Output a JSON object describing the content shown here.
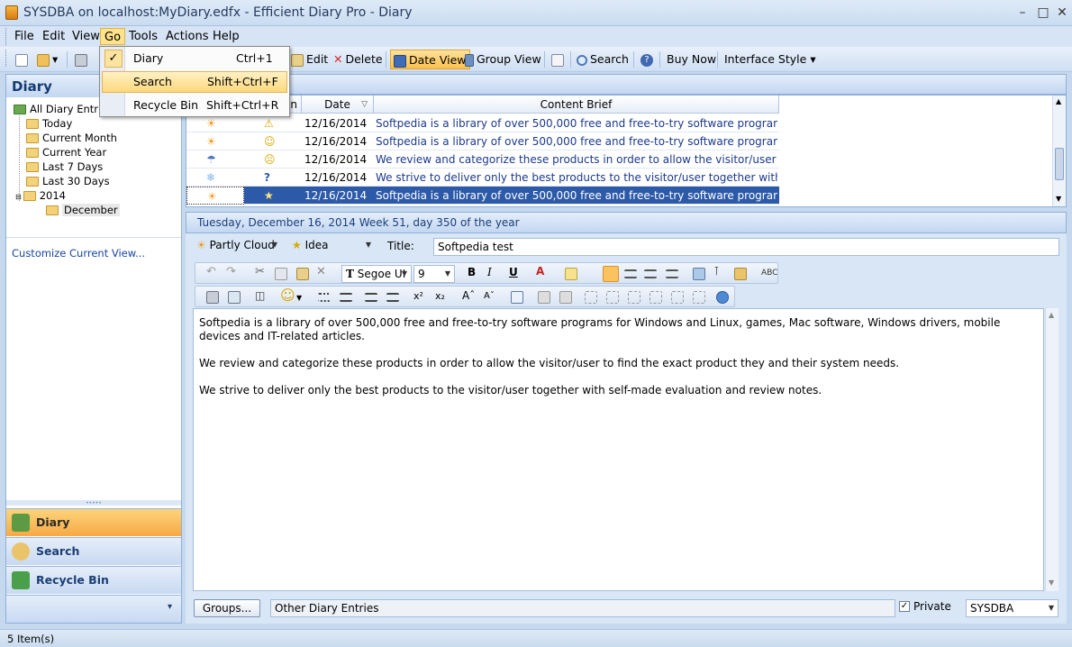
{
  "window": {
    "title": "SYSDBA on localhost:MyDiary.edfx - Efficient Diary Pro - Diary"
  },
  "menus": [
    "File",
    "Edit",
    "View",
    "Go",
    "Tools",
    "Actions",
    "Help"
  ],
  "go_menu": [
    {
      "label": "Diary",
      "shortcut": "Ctrl+1",
      "checked": true
    },
    {
      "label": "Search",
      "shortcut": "Shift+Ctrl+F",
      "highlighted": true
    },
    {
      "label": "Recycle Bin",
      "shortcut": "Shift+Ctrl+R"
    }
  ],
  "toolbar": {
    "edit": "Edit",
    "delete": "Delete",
    "date_view": "Date View",
    "group_view": "Group View",
    "search": "Search",
    "buy_now": "Buy Now",
    "interface_style": "Interface Style"
  },
  "left": {
    "header": "Diary",
    "tree": {
      "root": "All Diary Entries",
      "items": [
        "Today",
        "Current Month",
        "Current Year",
        "Last 7 Days",
        "Last 30 Days"
      ],
      "year": "2014",
      "month": "December"
    },
    "customize": "Customize Current View...",
    "nav": [
      "Diary",
      "Search",
      "Recycle Bin"
    ]
  },
  "grid": {
    "columns": {
      "mood_partial": "n",
      "date": "Date",
      "brief": "Content Brief"
    },
    "rows": [
      {
        "date": "12/16/2014",
        "brief": "Softpedia is a library of over 500,000 free and free-to-try software programs for Windo",
        "mood": "warning"
      },
      {
        "date": "12/16/2014",
        "brief": "Softpedia is a library of over 500,000 free and free-to-try software programs for Windo",
        "mood": "smile"
      },
      {
        "date": "12/16/2014",
        "brief": "We review and categorize these products in order to allow the visitor/user to find the",
        "mood": "sad"
      },
      {
        "date": "12/16/2014",
        "brief": "We strive to deliver only the best products to the visitor/user together with self-made",
        "mood": "question"
      },
      {
        "date": "12/16/2014",
        "brief": "Softpedia is a library of over 500,000 free and free-to-try software programs for Windo",
        "mood": "idea",
        "selected": true
      }
    ]
  },
  "datebar": "Tuesday, December 16, 2014  Week 51, day 350 of the year",
  "entry": {
    "weather": "Partly Cloud",
    "mood": "Idea",
    "title_label": "Title:",
    "title": "Softpedia test",
    "font": "Segoe UI",
    "size": "9",
    "paragraphs": [
      "Softpedia is a library of over 500,000 free and free-to-try software programs for Windows and Linux, games, Mac software, Windows drivers, mobile devices and IT-related articles.",
      "We review and categorize these products in order to allow the visitor/user to find the exact product they and their system needs.",
      "We strive to deliver only the best products to the visitor/user together with self-made evaluation and review notes."
    ],
    "groups_button": "Groups...",
    "groups_value": "Other Diary Entries",
    "private_label": "Private",
    "user": "SYSDBA"
  },
  "status": "5 Item(s)"
}
